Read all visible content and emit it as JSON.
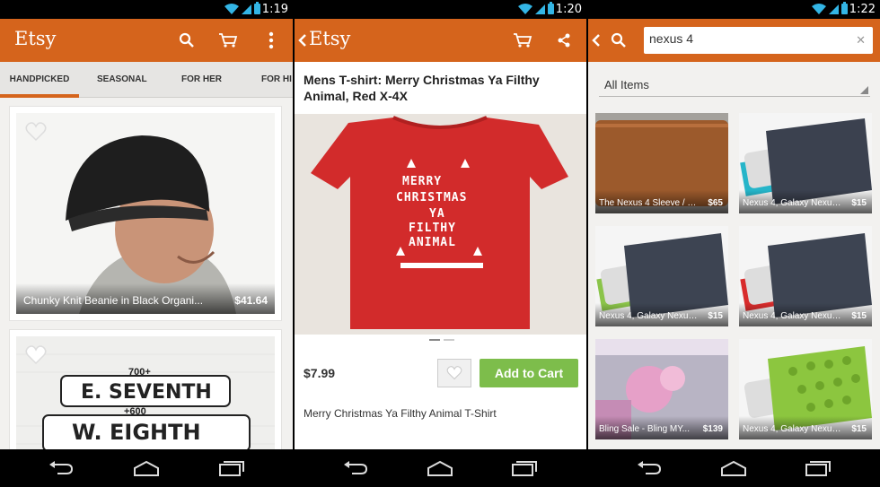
{
  "status": {
    "times": [
      "1:19",
      "1:20",
      "1:22"
    ]
  },
  "app": {
    "logo": "Etsy"
  },
  "home": {
    "tabs": [
      "HANDPICKED",
      "SEASONAL",
      "FOR HER",
      "FOR HI"
    ],
    "items": [
      {
        "title": "Chunky Knit Beanie in Black Organi...",
        "price": "$41.64"
      }
    ],
    "signs": [
      "700+",
      "E. SEVENTH",
      "+600",
      "W. EIGHTH"
    ]
  },
  "product": {
    "title": "Mens T-shirt: Merry Christmas Ya Filthy Animal, Red X-4X",
    "shirt_text": [
      "MERRY",
      "CHRISTMAS",
      "YA",
      "FILTHY",
      "ANIMAL"
    ],
    "price": "$7.99",
    "add_to_cart": "Add to Cart",
    "description": "Merry Christmas Ya Filthy Animal T-Shirt"
  },
  "search": {
    "query": "nexus 4",
    "filter": "All Items",
    "results": [
      {
        "title": "The Nexus 4 Sleeve / C...",
        "price": "$65",
        "color": "#9c5a2c"
      },
      {
        "title": "Nexus 4, Galaxy Nexus...",
        "price": "$15",
        "color": "#3b414f"
      },
      {
        "title": "Nexus 4, Galaxy Nexus...",
        "price": "$15",
        "color": "#3d4452"
      },
      {
        "title": "Nexus 4, Galaxy Nexus...",
        "price": "$15",
        "color": "#3d4452"
      },
      {
        "title": "Bling Sale - Bling MY...",
        "price": "$139",
        "color": "#c58cb5"
      },
      {
        "title": "Nexus 4, Galaxy Nexus...",
        "price": "$15",
        "color": "#8cc63f"
      }
    ]
  },
  "colors": {
    "accent": "#d5641c",
    "cart_green": "#7dbd4b"
  }
}
